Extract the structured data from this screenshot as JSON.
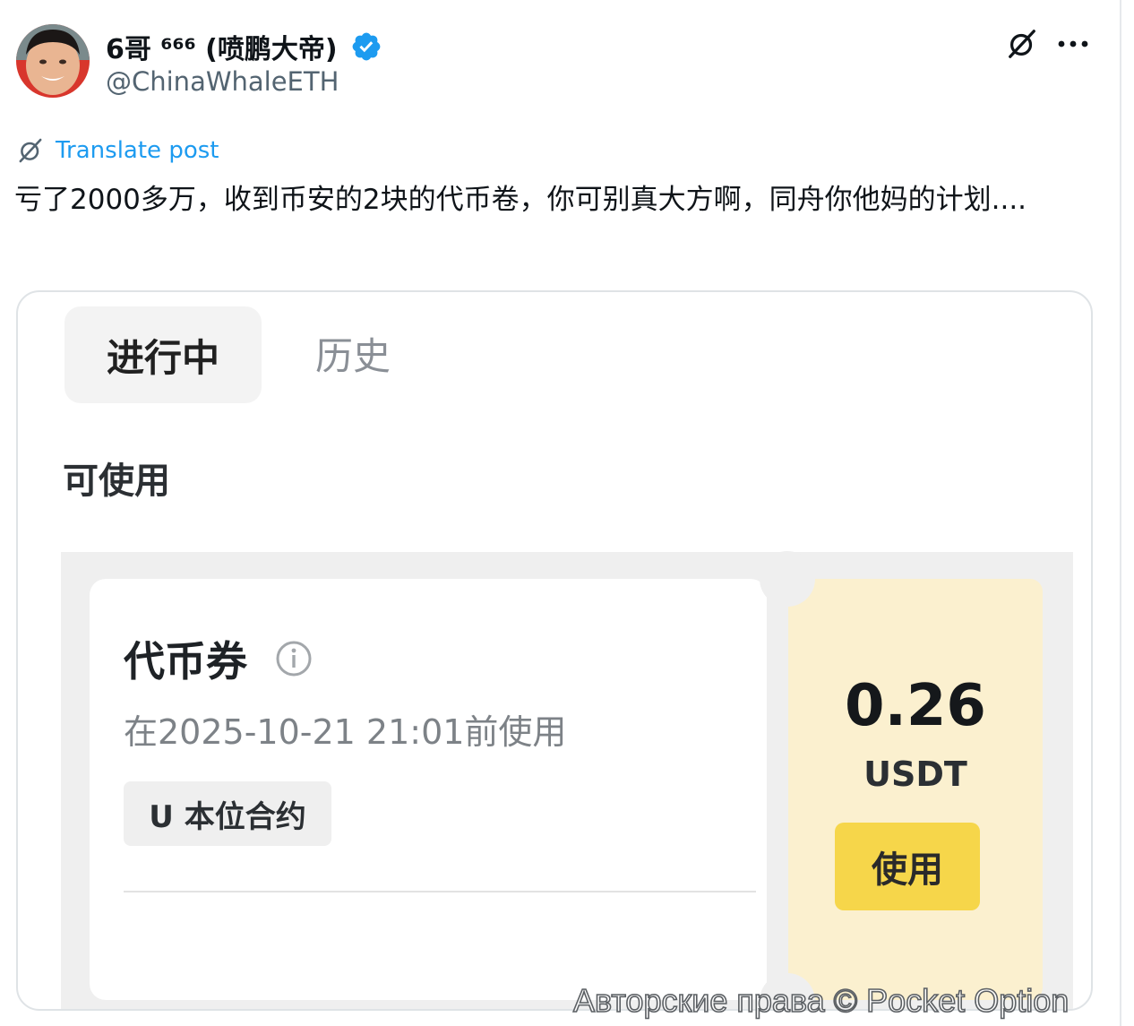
{
  "post": {
    "author_name": "6哥 ⁶⁶⁶ (喷鹏大帝)",
    "author_handle": "@ChinaWhaleETH",
    "translate_label": "Translate post",
    "text": "亏了2000多万，收到币安的2块的代币卷，你可别真大方啊，同舟你他妈的计划....",
    "icons": [
      "avatar",
      "verified-badge-icon",
      "grok-icon",
      "more-icon",
      "translate-icon"
    ],
    "accent_color": "#1d9bf0"
  },
  "media": {
    "tabs": [
      "进行中",
      "历史"
    ],
    "section_title": "可使用",
    "coupon": {
      "title": "代币券",
      "expiry": "在2025-10-21 21:01前使用",
      "tag": "U 本位合约",
      "amount": "0.26",
      "currency": "USDT",
      "use_button": "使用",
      "stub_color": "#fbf0cf",
      "button_color": "#f6d64a"
    }
  },
  "watermark": "Авторские права © Pocket Option"
}
